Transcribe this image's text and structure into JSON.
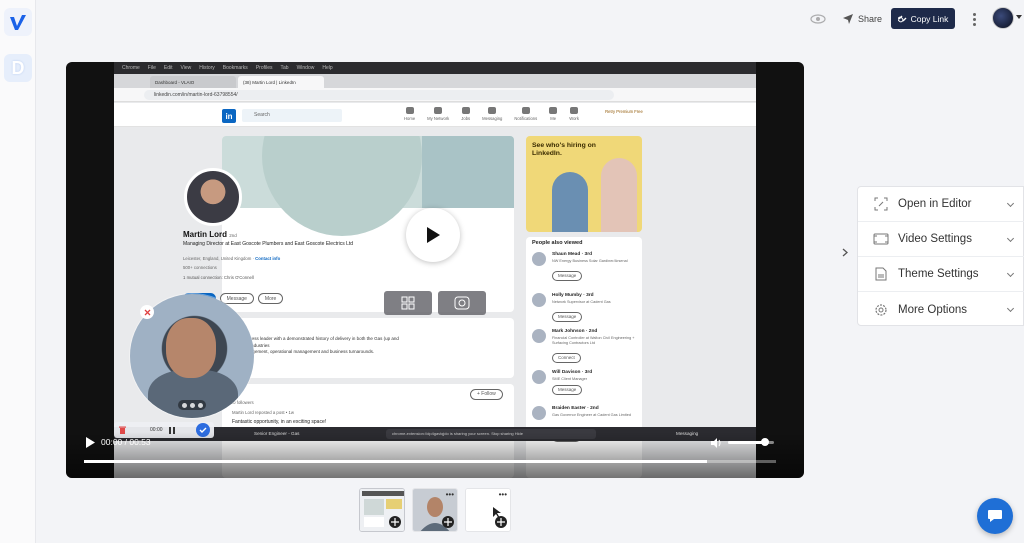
{
  "colors": {
    "accent": "#1e2a4a",
    "chat": "#1f6fd6",
    "linkedin": "#0a66c2",
    "recording_check": "#2d6cdf"
  },
  "rail": {
    "logo_icon": "vimeo-v-logo",
    "doc_icon": "d-doc-icon"
  },
  "topbar": {
    "share_label": "Share",
    "copy_link_label": "Copy Link"
  },
  "player": {
    "time": "00:00 / 00:53",
    "progress": 0.9,
    "volume": 0.8,
    "recording_timer": "00:00"
  },
  "screen": {
    "menubar": [
      "Chrome",
      "File",
      "Edit",
      "View",
      "History",
      "Bookmarks",
      "Profiles",
      "Tab",
      "Window",
      "Help"
    ],
    "tabs": [
      "Dashboard - VLAIO",
      "(38) Martin Lord | LinkedIn"
    ],
    "url": "linkedin.com/in/martin-lord-63798554/",
    "linkedin": {
      "logo": "in",
      "search_placeholder": "Search",
      "nav": [
        "Home",
        "My Network",
        "Jobs",
        "Messaging",
        "Notifications",
        "Me",
        "Work"
      ],
      "premium": "Retry Premium Free",
      "profile": {
        "name": "Martin Lord",
        "degree": "2nd",
        "headline": "Managing Director at East Goscote Plumbers and East Goscote Electrics Ltd",
        "location": "Leicester, England, United Kingdom",
        "contact_info": "Contact info",
        "connections": "500+ connections",
        "mutual": "1 mutual connection: Chris O'Connell",
        "btn_connect": "Connect",
        "btn_message": "Message",
        "btn_more": "More",
        "edu1": "te Electrics",
        "edu2": "op College"
      },
      "about_lines": [
        "ed team oriented business leader with a demonstrated history of delivery in both the Gas (up and",
        "ant) and Construction industries",
        "coaching, project management, operational management and business turnarounds."
      ],
      "activity": {
        "title": "ivity",
        "followers": "3920 followers",
        "follow_label": "+ Follow",
        "post_meta": "Martin Lord reposted a post • 1w",
        "post_text": "Fantastic opportunity, in an exciting space!"
      },
      "ad_text": "See who's hiring on LinkedIn.",
      "people_also_viewed": "People also viewed",
      "people": [
        {
          "name": "Shaun Mead",
          "deg": "3rd",
          "sub": "NW Energy Business Solar Gardiner/Arsenal",
          "btn": "Message"
        },
        {
          "name": "Holly Mumby",
          "deg": "3rd",
          "sub": "Network Supervisor at Cadent Gas",
          "btn": "Message"
        },
        {
          "name": "Mark Johnson",
          "deg": "2nd",
          "sub": "Financial Controller at Walton Civil Engineering + Surfacing Contractors Ltd",
          "btn": "Connect"
        },
        {
          "name": "Will Davison",
          "deg": "3rd",
          "sub": "SME Client Manager",
          "btn": "Message"
        },
        {
          "name": "Braiden Easter",
          "deg": "2nd",
          "sub": "Gas Governor Engineer at Cadent Gas Limited",
          "btn": "Connect"
        }
      ],
      "bottom": {
        "job": "Senior Engineer - Gas",
        "sharing": "chrome-extension://dp4gavlqjdo is sharing your screen.",
        "stop": "Stop sharing",
        "hide": "Hide",
        "messaging": "Messaging"
      }
    }
  },
  "panel": {
    "items": [
      {
        "label": "Open in Editor",
        "icon": "editor-icon"
      },
      {
        "label": "Video Settings",
        "icon": "video-settings-icon"
      },
      {
        "label": "Theme Settings",
        "icon": "theme-settings-icon"
      },
      {
        "label": "More Options",
        "icon": "gear-icon"
      }
    ]
  },
  "thumbnails": [
    {
      "kind": "screen"
    },
    {
      "kind": "camera"
    },
    {
      "kind": "cursor"
    }
  ]
}
